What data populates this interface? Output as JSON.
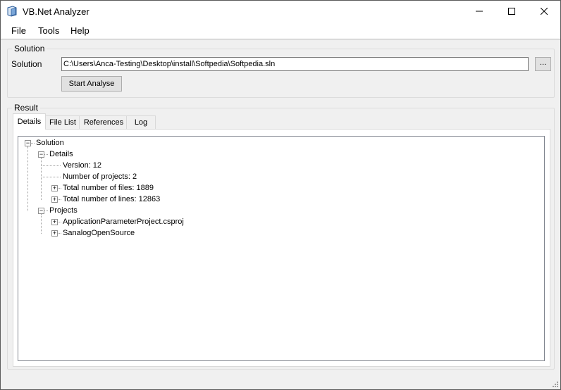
{
  "window": {
    "title": "VB.Net Analyzer"
  },
  "menu": {
    "items": [
      "File",
      "Tools",
      "Help"
    ]
  },
  "solution_group": {
    "label": "Solution",
    "field_label": "Solution",
    "path_value": "C:\\Users\\Anca-Testing\\Desktop\\install\\Softpedia\\Softpedia.sln",
    "browse_label": "...",
    "start_label": "Start Analyse"
  },
  "result_group": {
    "label": "Result",
    "tabs": [
      "Details",
      "File List",
      "References",
      "Log"
    ],
    "active_tab": "Details"
  },
  "tree": {
    "root": "Solution",
    "details": "Details",
    "version": "Version: 12",
    "num_projects": "Number of projects: 2",
    "total_files": "Total number of files: 1889",
    "total_lines": "Total number of lines: 12863",
    "projects": "Projects",
    "project1": "ApplicationParameterProject.csproj",
    "project2": "SanalogOpenSource"
  }
}
